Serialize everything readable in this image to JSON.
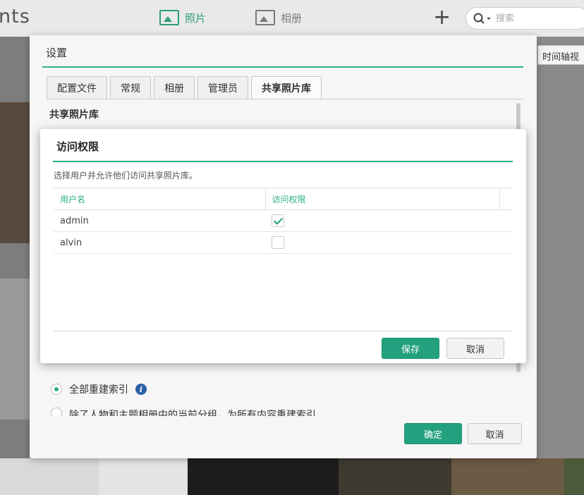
{
  "app": {
    "logo_text": "nts",
    "tabs": [
      {
        "label": "照片",
        "active": true
      },
      {
        "label": "相册",
        "active": false
      }
    ],
    "add_icon": "+",
    "search": {
      "placeholder": "搜索"
    },
    "timeline_button": "时间轴视"
  },
  "settings": {
    "title": "设置",
    "tabs": [
      "配置文件",
      "常规",
      "相册",
      "管理员",
      "共享照片库"
    ],
    "active_tab": "共享照片库",
    "section_heading": "共享照片库",
    "options": [
      {
        "label": "全部重建索引",
        "checked": true
      },
      {
        "label": "除了人物和主题相册中的当前分组，为所有内容重建索引",
        "checked": false
      }
    ],
    "ok_label": "确定",
    "cancel_label": "取消"
  },
  "access": {
    "title": "访问权限",
    "description": "选择用户并允许他们访问共享照片库。",
    "columns": [
      "用户名",
      "访问权限"
    ],
    "rows": [
      {
        "username": "admin",
        "access": true
      },
      {
        "username": "alvin",
        "access": false
      }
    ],
    "save_label": "保存",
    "cancel_label": "取消"
  },
  "colors": {
    "accent": "#2aae8c",
    "primary_button": "#23a17f",
    "info": "#2c5ea8"
  }
}
